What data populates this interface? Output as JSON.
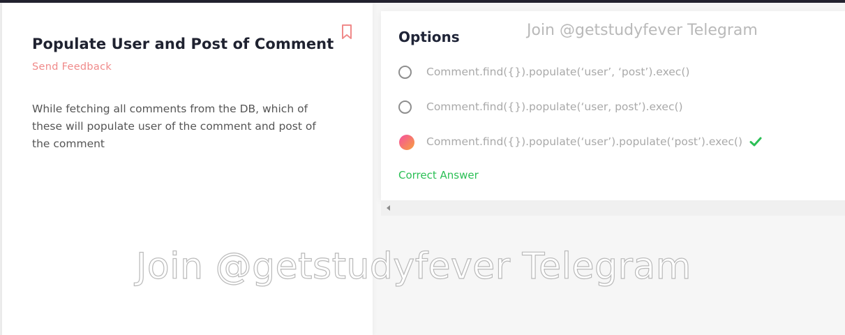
{
  "question": {
    "title": "Populate User and Post of Comment",
    "feedback_label": "Send Feedback",
    "text": "While fetching all comments from the DB, which of these will populate user of the comment and post of the comment"
  },
  "options": {
    "title": "Options",
    "items": [
      {
        "label": "Comment.find({}).populate(‘user’, ‘post’).exec()",
        "selected": false
      },
      {
        "label": "Comment.find({}).populate(‘user, post’).exec()",
        "selected": false
      },
      {
        "label": "Comment.find({}).populate(‘user’).populate(‘post’).exec()",
        "selected": true
      }
    ],
    "correct_label": "Correct Answer"
  },
  "watermark": {
    "top": "Join @getstudyfever Telegram",
    "center": "Join @getstudyfever Telegram"
  },
  "colors": {
    "accent": "#f08a8a",
    "correct": "#2bbf55",
    "topbar": "#23222f"
  },
  "icons": {
    "bookmark": "bookmark-icon",
    "check": "check-icon",
    "scroll": "scroll-left-arrow-icon"
  }
}
